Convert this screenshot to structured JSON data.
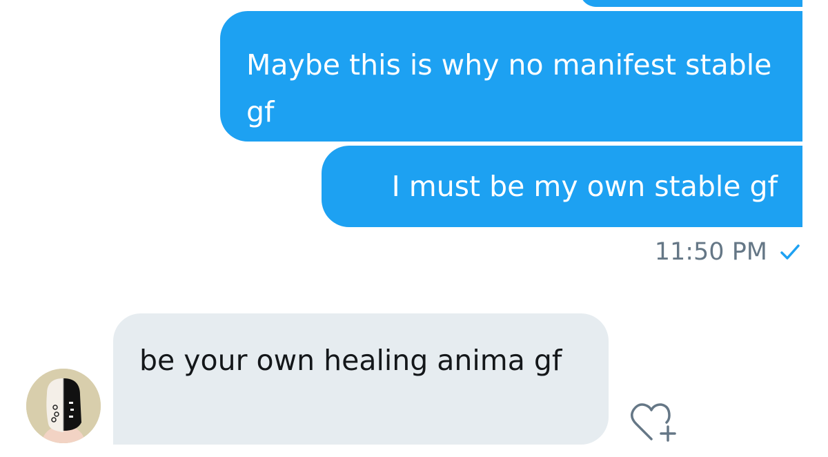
{
  "conversation": {
    "messages": [
      {
        "direction": "outgoing",
        "text": "Maybe this is why no manifest stable gf"
      },
      {
        "direction": "outgoing",
        "text": "I must be my own stable gf"
      },
      {
        "direction": "incoming",
        "text": "be your own healing anima gf"
      }
    ],
    "outgoing_timestamp": "11:50 PM",
    "read_status_icon": "checkmark-icon"
  },
  "colors": {
    "outgoing_bubble": "#1da1f2",
    "incoming_bubble": "#e6ecf0",
    "timestamp": "#657786",
    "check": "#1da1f2",
    "heart_outline": "#657786"
  },
  "icons": {
    "avatar": "masked-figure-avatar",
    "reaction": "heart-plus-icon"
  }
}
